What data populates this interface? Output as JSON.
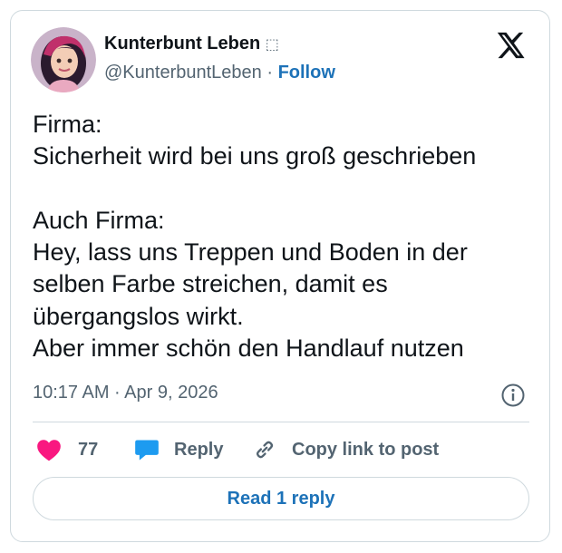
{
  "author": {
    "name": "Kunterbunt Leben",
    "name_suffix_glyph": "⬚",
    "handle": "@KunterbuntLeben",
    "separator": " · ",
    "follow_label": "Follow"
  },
  "post": {
    "lines": [
      "Firma:",
      "Sicherheit wird bei uns groß geschrieben",
      "",
      "Auch Firma:",
      "Hey, lass uns Treppen und Boden in der",
      "selben Farbe streichen, damit es",
      "übergangslos wirkt.",
      "Aber immer schön den Handlauf nutzen"
    ],
    "timestamp": "10:17 AM · Apr 9, 2026"
  },
  "actions": {
    "like_count": "77",
    "reply_label": "Reply",
    "copy_label": "Copy link to post"
  },
  "read_reply_label": "Read 1 reply",
  "colors": {
    "like": "#f91880",
    "reply": "#1d9bf0",
    "link": "#1d72b8",
    "muted": "#536471",
    "border": "#cfd9de"
  },
  "icons": [
    "x-logo-icon",
    "info-icon",
    "heart-icon",
    "reply-bubble-icon",
    "link-icon"
  ]
}
